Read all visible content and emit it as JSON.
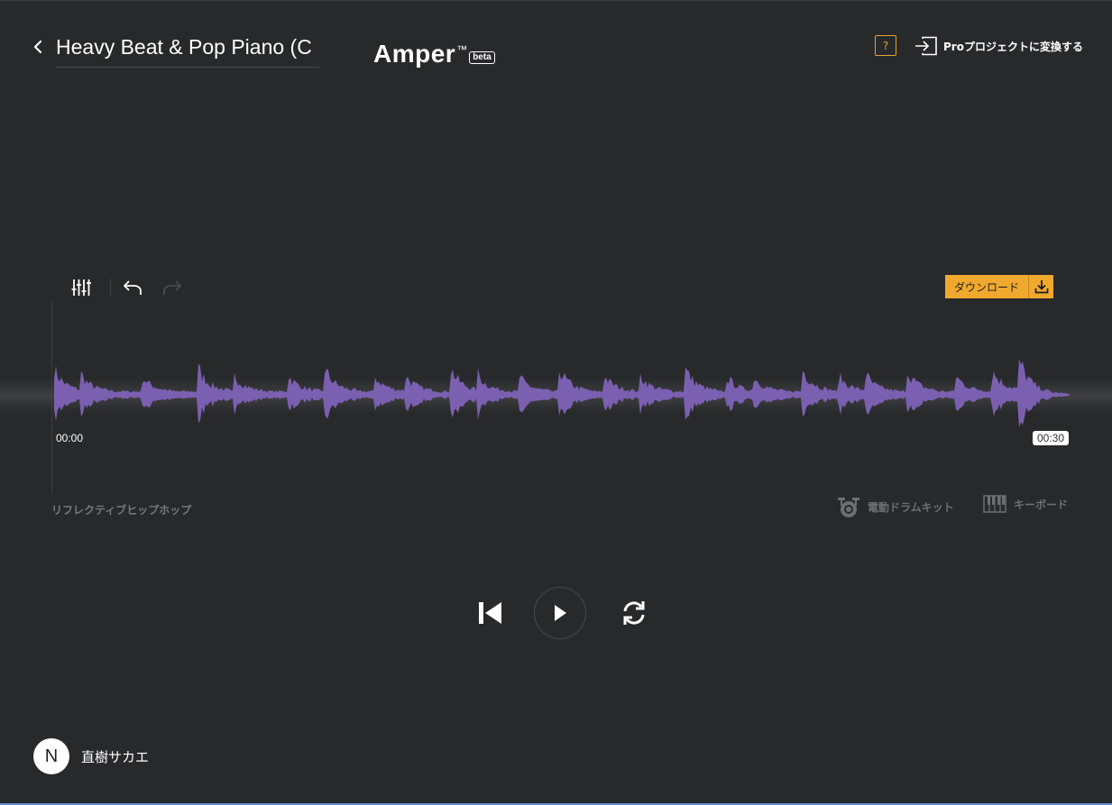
{
  "project": {
    "title": "Heavy Beat & Pop Piano (C"
  },
  "brand": {
    "name": "Amper",
    "tm": "™",
    "badge": "beta"
  },
  "header": {
    "help_label": "?",
    "convert_label": "Proプロジェクトに変換する"
  },
  "toolbar": {
    "download_label": "ダウンロード"
  },
  "timeline": {
    "start": "00:00",
    "end": "00:30",
    "waveform_color": "#7b5fb0"
  },
  "track": {
    "genre": "リフレクティブヒップホップ",
    "instruments": [
      {
        "label": "電動ドラムキット",
        "icon": "drum-icon"
      },
      {
        "label": "キーボード",
        "icon": "keyboard-icon"
      }
    ]
  },
  "user": {
    "initial": "N",
    "name": "直樹サカエ"
  },
  "colors": {
    "background": "#28292b",
    "accent": "#f0a92e",
    "waveform": "#7b5fb0"
  }
}
